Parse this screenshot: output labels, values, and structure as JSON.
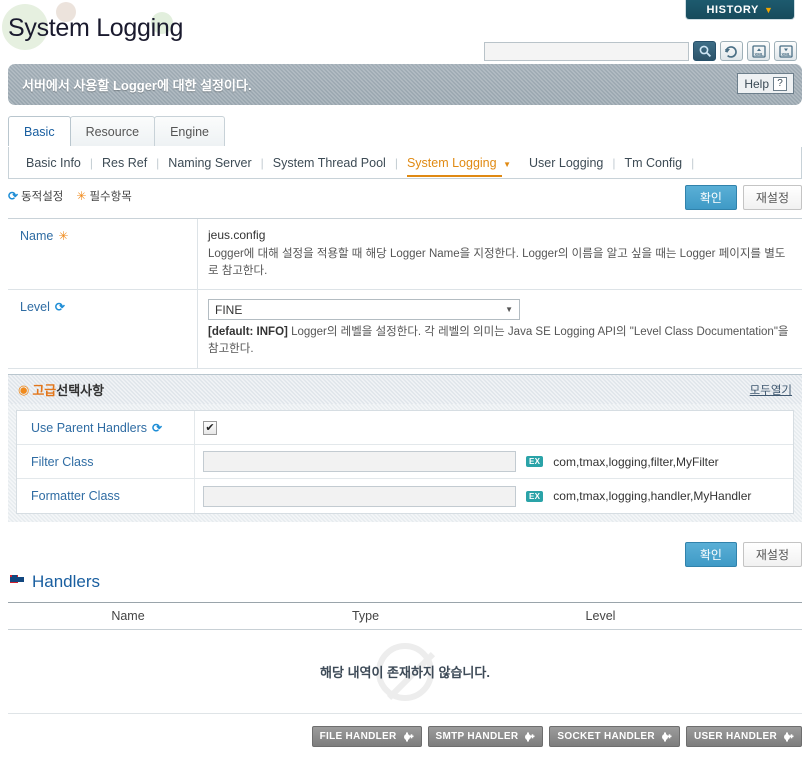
{
  "header": {
    "history_label": "HISTORY",
    "history_caret": "▼",
    "page_title": "System Logging"
  },
  "search": {
    "value": "",
    "placeholder": "",
    "icons": [
      "search-icon",
      "refresh-icon",
      "xml-upload-icon",
      "xml-download-icon"
    ]
  },
  "banner": {
    "text": "서버에서 사용할 Logger에 대한 설정이다.",
    "help_label": "Help",
    "help_icon": "?"
  },
  "tabs": [
    {
      "label": "Basic",
      "active": true
    },
    {
      "label": "Resource",
      "active": false
    },
    {
      "label": "Engine",
      "active": false
    }
  ],
  "subnav": [
    {
      "label": "Basic Info",
      "active": false
    },
    {
      "label": "Res Ref",
      "active": false
    },
    {
      "label": "Naming Server",
      "active": false
    },
    {
      "label": "System Thread Pool",
      "active": false
    },
    {
      "label": "System Logging",
      "active": true
    },
    {
      "label": "User Logging",
      "active": false
    },
    {
      "label": "Tm Config",
      "active": false
    }
  ],
  "legend": {
    "dynamic": "동적설정",
    "required": "필수항목"
  },
  "actions": {
    "confirm": "확인",
    "reset": "재설정"
  },
  "form": {
    "name": {
      "label": "Name",
      "value": "jeus.config",
      "description": "Logger에 대해 설정을 적용할 때 해당 Logger Name을 지정한다. Logger의 이름을 알고 싶을 때는 Logger 페이지를 별도로 참고한다."
    },
    "level": {
      "label": "Level",
      "selected": "FINE",
      "default_tag": "[default: INFO]",
      "description": "Logger의 레벨을 설정한다. 각 레벨의 의미는 Java SE Logging API의 \"Level Class Documentation\"을 참고한다."
    }
  },
  "advanced": {
    "title_accent": "고급",
    "title_rest": "선택사항",
    "open_all": "모두열기",
    "rows": [
      {
        "label": "Use Parent Handlers",
        "type": "checkbox",
        "checked": true,
        "dynamic": true,
        "example": ""
      },
      {
        "label": "Filter Class",
        "type": "text",
        "value": "",
        "dynamic": false,
        "example_badge": "EX",
        "example": "com,tmax,logging,filter,MyFilter"
      },
      {
        "label": "Formatter Class",
        "type": "text",
        "value": "",
        "dynamic": false,
        "example_badge": "EX",
        "example": "com,tmax,logging,handler,MyHandler"
      }
    ]
  },
  "handlers": {
    "title": "Handlers",
    "columns": [
      "Name",
      "Type",
      "Level"
    ],
    "rows": [],
    "empty_message": "해당 내역이 존재하지 않습니다.",
    "buttons": [
      {
        "label": "FILE HANDLER"
      },
      {
        "label": "SMTP HANDLER"
      },
      {
        "label": "SOCKET HANDLER"
      },
      {
        "label": "USER HANDLER"
      }
    ]
  }
}
